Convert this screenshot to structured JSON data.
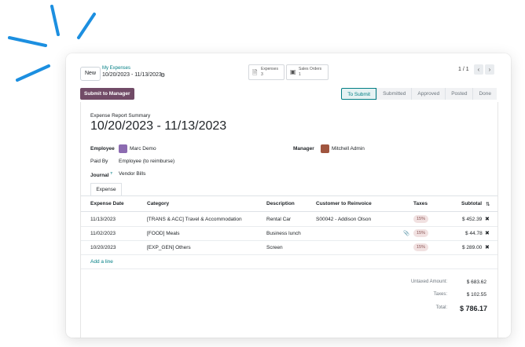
{
  "control_panel": {
    "new_label": "New",
    "breadcrumb_parent": "My Expenses",
    "breadcrumb_current": "10/20/2023 - 11/13/2023",
    "smart_buttons": [
      {
        "label": "Expenses",
        "count": "3"
      },
      {
        "label": "Sales Orders",
        "count": "1"
      }
    ],
    "pager": "1 / 1"
  },
  "statusbar": {
    "action_label": "Submit to Manager",
    "stages": [
      "To Submit",
      "Submitted",
      "Approved",
      "Posted",
      "Done"
    ],
    "active_stage": "To Submit"
  },
  "form": {
    "summary_label": "Expense Report Summary",
    "title": "10/20/2023 - 11/13/2023",
    "employee_label": "Employee",
    "employee_value": "Marc Demo",
    "manager_label": "Manager",
    "manager_value": "Mitchell Admin",
    "paid_by_label": "Paid By",
    "paid_by_value": "Employee (to reimburse)",
    "journal_label": "Journal",
    "journal_sup": "?",
    "journal_value": "Vendor Bills"
  },
  "tab_label": "Expense",
  "table": {
    "headers": [
      "Expense Date",
      "Category",
      "Description",
      "Customer to Reinvoice",
      "Taxes",
      "Subtotal"
    ],
    "rows": [
      {
        "date": "11/13/2023",
        "category": "[TRANS & ACC] Travel & Accommodation",
        "description": "Rental Car",
        "customer": "S00042 - Addison Olson",
        "tax": "15%",
        "subtotal": "$ 452.39"
      },
      {
        "date": "11/02/2023",
        "category": "[FOOD] Meals",
        "description": "Business lunch",
        "customer": "",
        "tax": "15%",
        "subtotal": "$ 44.78"
      },
      {
        "date": "10/20/2023",
        "category": "[EXP_GEN] Others",
        "description": "Screen",
        "customer": "",
        "tax": "15%",
        "subtotal": "$ 289.00"
      }
    ],
    "add_line": "Add a line"
  },
  "totals": {
    "untaxed_label": "Untaxed Amount:",
    "untaxed_value": "$ 683.62",
    "taxes_label": "Taxes:",
    "taxes_value": "$ 102.55",
    "total_label": "Total:",
    "total_value": "$ 786.17"
  },
  "colors": {
    "brand": "#714b67",
    "accent": "#017e84",
    "burst": "#1c8fe0"
  }
}
